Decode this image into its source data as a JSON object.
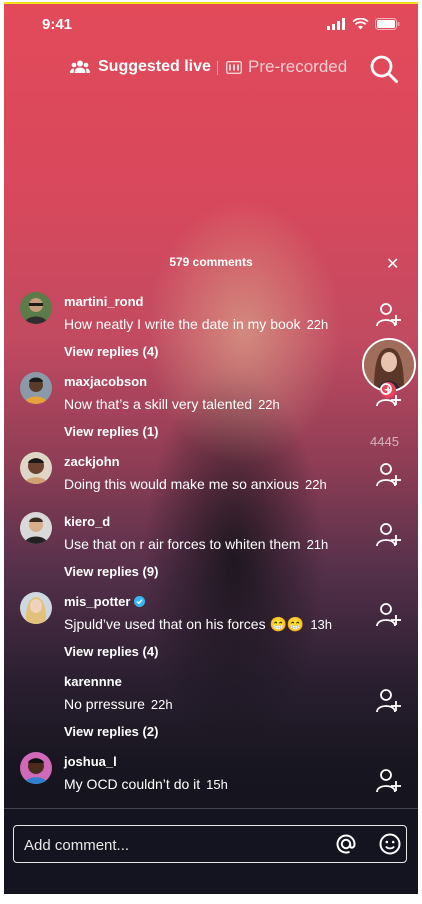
{
  "status": {
    "time": "9:41"
  },
  "nav": {
    "suggested_live": "Suggested live",
    "pre_recorded": "Pre-recorded"
  },
  "comments_header": {
    "title": "579 comments"
  },
  "comments": [
    {
      "username": "martini_rond",
      "text": "How neatly I write the date in my book",
      "time": "22h",
      "replies": "View replies (4)"
    },
    {
      "username": "maxjacobson",
      "text": "Now that’s a skill very talented",
      "time": "22h",
      "replies": "View replies (1)"
    },
    {
      "username": "zackjohn",
      "text": "Doing this would make me so anxious",
      "time": "22h",
      "replies": ""
    },
    {
      "username": "kiero_d",
      "text": "Use that on r air forces to whiten them",
      "time": "21h",
      "replies": "View replies (9)"
    },
    {
      "username": "mis_potter",
      "text": "Sjpuld’ve used that on his forces 😁😁",
      "time": "13h",
      "replies": "View replies (4)"
    },
    {
      "username": "karennne",
      "text": "No prressure",
      "time": "22h",
      "replies": "View replies (2)"
    },
    {
      "username": "joshua_l",
      "text": "My OCD couldn’t do it",
      "time": "15h",
      "replies": ""
    }
  ],
  "host": {
    "like_count": "4445"
  },
  "composer": {
    "placeholder": "Add comment..."
  },
  "colors": {
    "accent": "#e8455b",
    "verified": "#3ab7f0",
    "background": "#141420"
  }
}
